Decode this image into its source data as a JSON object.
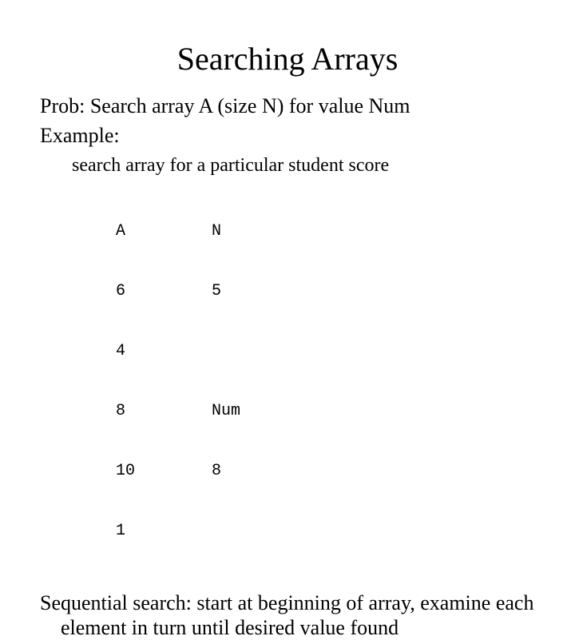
{
  "title": "Searching Arrays",
  "line1": "Prob: Search array A (size N) for value Num",
  "line2": "Example:",
  "subline": "search array for a particular student score",
  "table": {
    "r0": {
      "a": "A",
      "b": "N"
    },
    "r1": {
      "a": "6",
      "b": "5"
    },
    "r2": {
      "a": "4",
      "b": ""
    },
    "r3": {
      "a": "8",
      "b": "Num"
    },
    "r4": {
      "a": "10",
      "b": "8"
    },
    "r5": {
      "a": "1",
      "b": ""
    }
  },
  "bottom": "Sequential search: start at beginning of array, examine each element in turn until desired value found"
}
